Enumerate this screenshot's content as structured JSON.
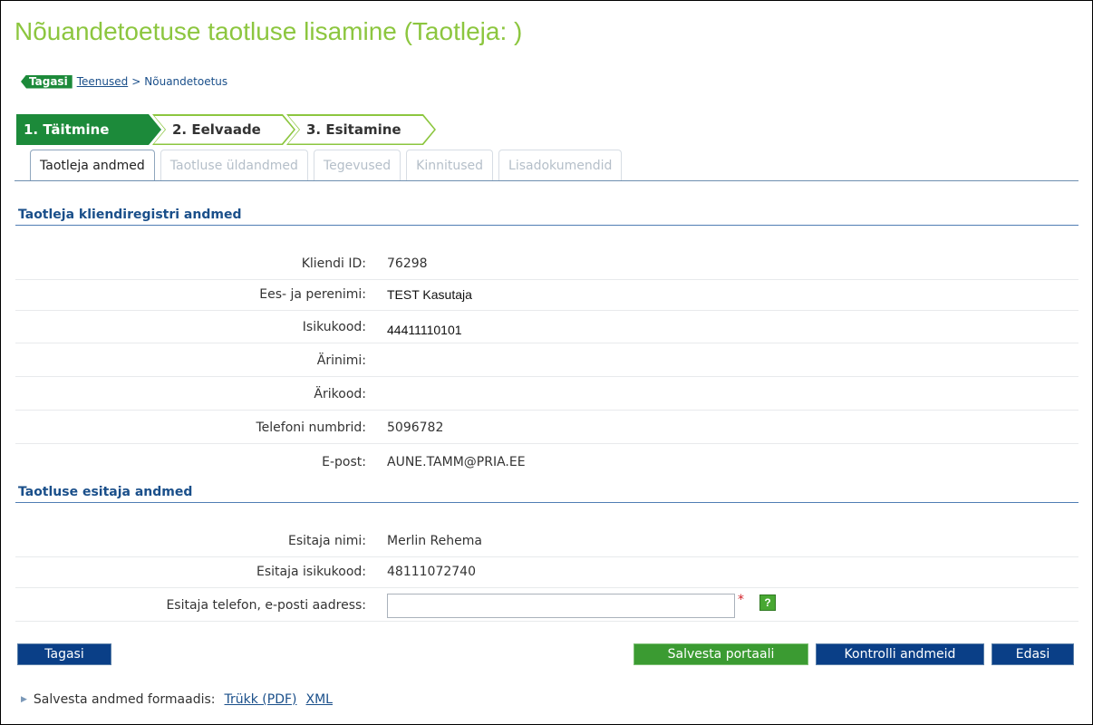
{
  "page": {
    "title": "Nõuandetoetuse taotluse lisamine (Taotleja:  )"
  },
  "breadcrumb": {
    "back_label": "Tagasi",
    "link": "Teenused",
    "separator": ">",
    "current": "Nõuandetoetus"
  },
  "steps": [
    {
      "label": "1. Täitmine"
    },
    {
      "label": "2. Eelvaade"
    },
    {
      "label": "3. Esitamine"
    }
  ],
  "tabs": [
    {
      "label": "Taotleja andmed"
    },
    {
      "label": "Taotluse üldandmed"
    },
    {
      "label": "Tegevused"
    },
    {
      "label": "Kinnitused"
    },
    {
      "label": "Lisadokumendid"
    }
  ],
  "client_section": {
    "title": "Taotleja kliendiregistri andmed",
    "rows": [
      {
        "label": "Kliendi ID:",
        "value": "76298"
      },
      {
        "label": "Ees- ja perenimi:",
        "value": "TEST Kasutaja"
      },
      {
        "label": "Isikukood:",
        "value": "44411110101"
      },
      {
        "label": "Ärinimi:",
        "value": ""
      },
      {
        "label": "Ärikood:",
        "value": ""
      },
      {
        "label": "Telefoni numbrid:",
        "value": "5096782"
      },
      {
        "label": "E-post:",
        "value": "AUNE.TAMM@PRIA.EE"
      }
    ]
  },
  "submitter_section": {
    "title": "Taotluse esitaja andmed",
    "rows": [
      {
        "label": "Esitaja nimi:",
        "value": "Merlin Rehema"
      },
      {
        "label": "Esitaja isikukood:",
        "value": "48111072740"
      }
    ],
    "contact": {
      "label": "Esitaja telefon, e-posti aadress:",
      "value": "",
      "required_mark": "*",
      "help_label": "?"
    }
  },
  "actions": {
    "back": "Tagasi",
    "save_portal": "Salvesta portaali",
    "check_data": "Kontrolli andmeid",
    "next": "Edasi"
  },
  "formats": {
    "label": "Salvesta andmed formaadis:",
    "pdf": "Trükk (PDF)",
    "xml": "XML"
  },
  "colors": {
    "title_green": "#8cc63f",
    "step_active": "#1c8a3a",
    "button_blue": "#0a3f87",
    "button_green": "#3b9b32",
    "link_blue": "#1a4f8a"
  }
}
